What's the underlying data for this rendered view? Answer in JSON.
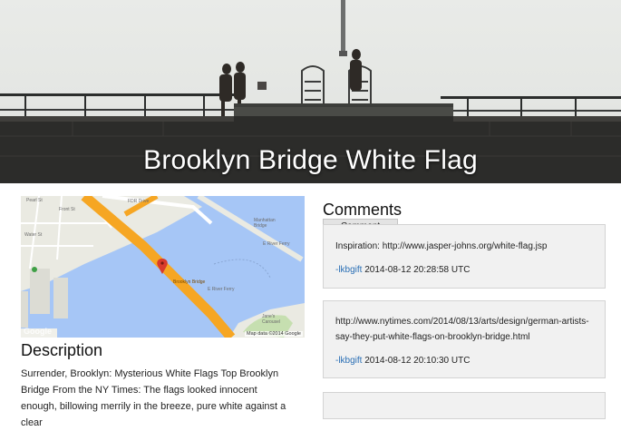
{
  "hero": {
    "title": "Brooklyn Bridge White Flag"
  },
  "map": {
    "labels": {
      "pearl_st": "Pearl St",
      "front_st": "Front St",
      "water_st": "Water St",
      "fdr_drive": "FDR Drive",
      "manhattan_bridge": "Manhattan Bridge",
      "e_river_ferry_1": "E River Ferry",
      "e_river_ferry_2": "E River Ferry",
      "brooklyn_bridge": "Brooklyn Bridge",
      "janes_carousel": "Jane's Carousel"
    },
    "google": "Google",
    "credit": "Map data ©2014 Google",
    "colors": {
      "water": "#a6c6f6",
      "land": "#eaeae2",
      "bridge": "#f6a623",
      "park": "#c6dfb0",
      "marker": "#d93a2b"
    }
  },
  "description": {
    "heading": "Description",
    "text": "Surrender, Brooklyn: Mysterious White Flags Top Brooklyn Bridge From the NY Times: The flags looked innocent enough, billowing merrily in the breeze, pure white against a clear"
  },
  "comments": {
    "heading": "Comments",
    "tab_label": "Comment",
    "items": [
      {
        "text": "Inspiration: http://www.jasper-johns.org/white-flag.jsp",
        "author": "-lkbgift",
        "timestamp": "2014-08-12 20:28:58 UTC"
      },
      {
        "text": "http://www.nytimes.com/2014/08/13/arts/design/german-artists-say-they-put-white-flags-on-brooklyn-bridge.html",
        "author": "-lkbgift",
        "timestamp": "2014-08-12 20:10:30 UTC"
      }
    ]
  }
}
